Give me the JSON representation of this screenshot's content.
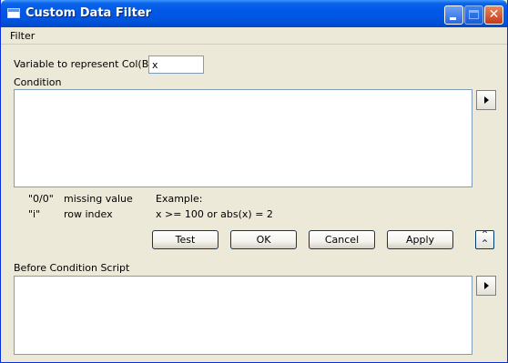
{
  "window": {
    "title": "Custom Data Filter"
  },
  "menu": {
    "items": [
      "Filter"
    ]
  },
  "variable": {
    "label": "Variable to represent Col(B)",
    "value": "x"
  },
  "condition": {
    "label": "Condition",
    "value": ""
  },
  "legend": {
    "items": [
      {
        "code": "\"0/0\"",
        "desc": "missing value"
      },
      {
        "code": "\"i\"",
        "desc": "row index"
      }
    ],
    "example_label": "Example:",
    "example_text": "x >= 100 or abs(x) = 2"
  },
  "buttons": {
    "test": "Test",
    "ok": "OK",
    "cancel": "Cancel",
    "apply": "Apply"
  },
  "before_script": {
    "label": "Before Condition Script",
    "value": ""
  },
  "icons": {
    "title": "window-icon",
    "arrow": "arrow-right-icon",
    "collapse": "double-chevron-up-icon"
  }
}
